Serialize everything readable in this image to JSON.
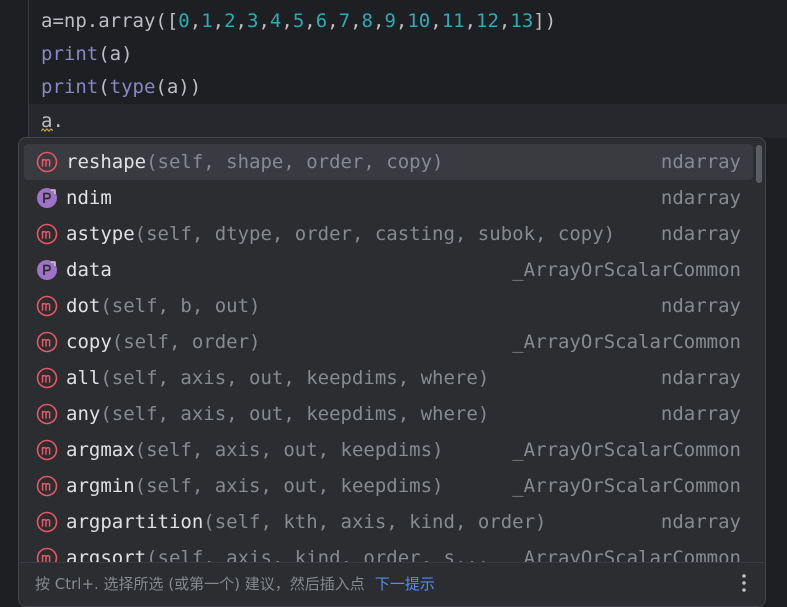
{
  "editor": {
    "lines": [
      {
        "parts": [
          {
            "t": "a=np.array([",
            "c": "plain"
          },
          {
            "t": "0",
            "c": "num"
          },
          {
            "t": ",",
            "c": "plain"
          },
          {
            "t": "1",
            "c": "num"
          },
          {
            "t": ",",
            "c": "plain"
          },
          {
            "t": "2",
            "c": "num"
          },
          {
            "t": ",",
            "c": "plain"
          },
          {
            "t": "3",
            "c": "num"
          },
          {
            "t": ",",
            "c": "plain"
          },
          {
            "t": "4",
            "c": "num"
          },
          {
            "t": ",",
            "c": "plain"
          },
          {
            "t": "5",
            "c": "num"
          },
          {
            "t": ",",
            "c": "plain"
          },
          {
            "t": "6",
            "c": "num"
          },
          {
            "t": ",",
            "c": "plain"
          },
          {
            "t": "7",
            "c": "num"
          },
          {
            "t": ",",
            "c": "plain"
          },
          {
            "t": "8",
            "c": "num"
          },
          {
            "t": ",",
            "c": "plain"
          },
          {
            "t": "9",
            "c": "num"
          },
          {
            "t": ",",
            "c": "plain"
          },
          {
            "t": "10",
            "c": "num"
          },
          {
            "t": ",",
            "c": "plain"
          },
          {
            "t": "11",
            "c": "num"
          },
          {
            "t": ",",
            "c": "plain"
          },
          {
            "t": "12",
            "c": "num"
          },
          {
            "t": ",",
            "c": "plain"
          },
          {
            "t": "13",
            "c": "num"
          },
          {
            "t": "])",
            "c": "plain"
          }
        ]
      },
      {
        "parts": [
          {
            "t": "print",
            "c": "builtin"
          },
          {
            "t": "(a)",
            "c": "plain"
          }
        ]
      },
      {
        "parts": [
          {
            "t": "print",
            "c": "builtin"
          },
          {
            "t": "(",
            "c": "plain"
          },
          {
            "t": "type",
            "c": "builtin"
          },
          {
            "t": "(a))",
            "c": "plain"
          }
        ]
      },
      {
        "parts": [
          {
            "t": "a.",
            "c": "plain"
          }
        ]
      }
    ]
  },
  "completion": {
    "items": [
      {
        "kind": "method",
        "name": "reshape",
        "params": "(self, shape, order, copy)",
        "type": "ndarray",
        "selected": true
      },
      {
        "kind": "property",
        "name": "ndim",
        "params": "",
        "type": "ndarray"
      },
      {
        "kind": "method",
        "name": "astype",
        "params": "(self, dtype, order, casting, subok, copy)",
        "type": "ndarray"
      },
      {
        "kind": "property",
        "name": "data",
        "params": "",
        "type": "_ArrayOrScalarCommon"
      },
      {
        "kind": "method",
        "name": "dot",
        "params": "(self, b, out)",
        "type": "ndarray"
      },
      {
        "kind": "method",
        "name": "copy",
        "params": "(self, order)",
        "type": "_ArrayOrScalarCommon"
      },
      {
        "kind": "method",
        "name": "all",
        "params": "(self, axis, out, keepdims, where)",
        "type": "ndarray"
      },
      {
        "kind": "method",
        "name": "any",
        "params": "(self, axis, out, keepdims, where)",
        "type": "ndarray"
      },
      {
        "kind": "method",
        "name": "argmax",
        "params": "(self, axis, out, keepdims)",
        "type": "_ArrayOrScalarCommon"
      },
      {
        "kind": "method",
        "name": "argmin",
        "params": "(self, axis, out, keepdims)",
        "type": "_ArrayOrScalarCommon"
      },
      {
        "kind": "method",
        "name": "argpartition",
        "params": "(self, kth, axis, kind, order)",
        "type": "ndarray"
      },
      {
        "kind": "method",
        "name": "argsort",
        "params": "(self, axis, kind, order, s...",
        "type": "_ArrayOrScalarCommon"
      }
    ],
    "footer": {
      "hint": "按 Ctrl+. 选择所选 (或第一个) 建议，然后插入点",
      "link": "下一提示"
    }
  },
  "colors": {
    "background": "#1e1f22",
    "popup": "#2b2d30",
    "selected": "#393b40",
    "method_icon": "#e55765",
    "property_icon": "#9f72c7",
    "link": "#548af7"
  },
  "icons": {
    "method": "method-m-icon",
    "property": "property-p-icon",
    "more": "more-vertical-icon"
  }
}
